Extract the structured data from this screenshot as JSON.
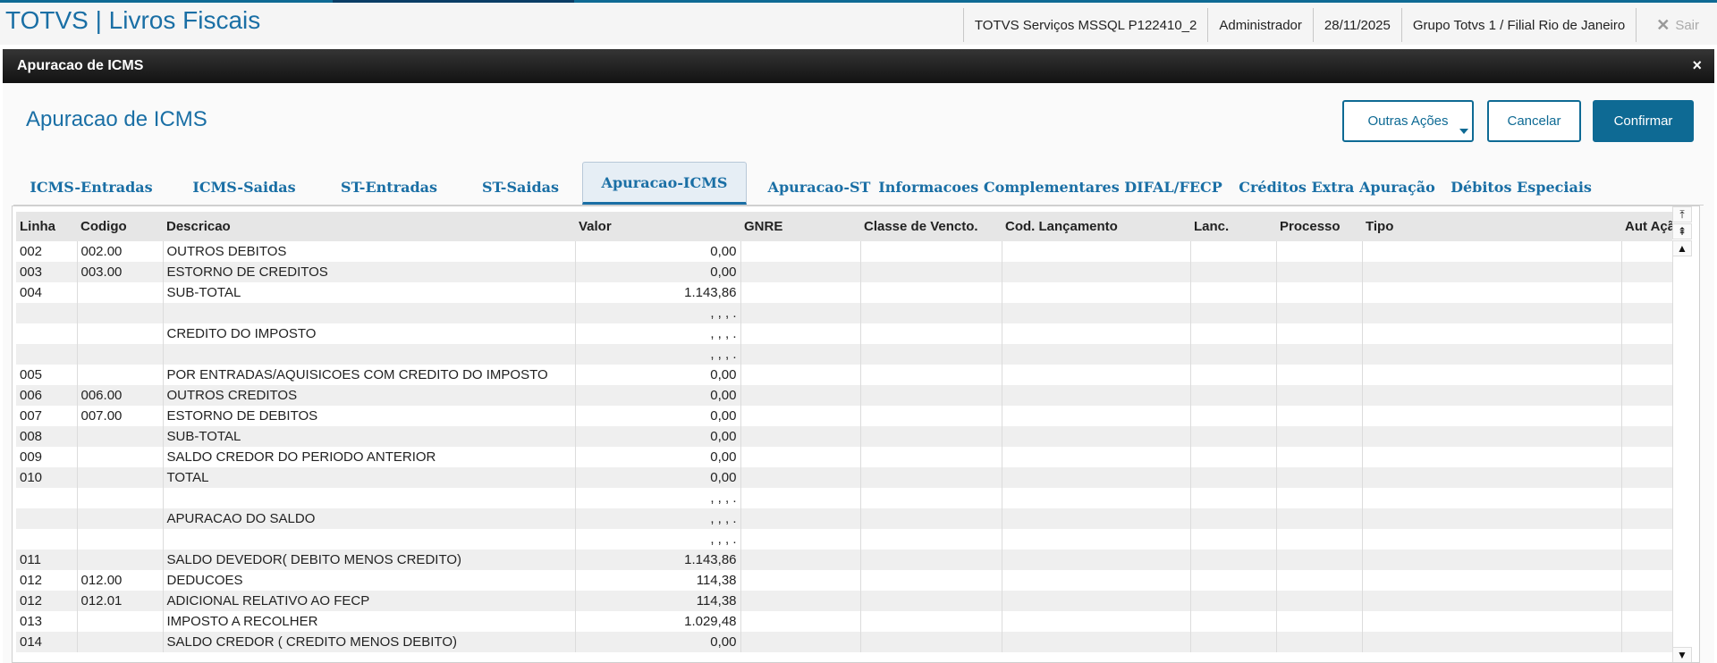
{
  "app": {
    "title": "TOTVS | Livros Fiscais",
    "server": "TOTVS Serviços MSSQL P122410_2",
    "user": "Administrador",
    "date": "28/11/2025",
    "branch": "Grupo Totvs 1 / Filial Rio de Janeiro",
    "exit_label": "Sair"
  },
  "dialog": {
    "title": "Apuracao de ICMS",
    "close_icon": "×",
    "heading": "Apuracao de ICMS",
    "buttons": {
      "other_actions": "Outras Ações",
      "cancel": "Cancelar",
      "confirm": "Confirmar"
    }
  },
  "tabs": [
    {
      "label": "ICMS-Entradas",
      "active": false
    },
    {
      "label": "ICMS-Saidas",
      "active": false
    },
    {
      "label": "ST-Entradas",
      "active": false
    },
    {
      "label": "ST-Saidas",
      "active": false
    },
    {
      "label": "Apuracao-ICMS",
      "active": true
    },
    {
      "label": "Apuracao-ST",
      "active": false
    },
    {
      "label": "Informacoes Complementares",
      "active": false
    },
    {
      "label": "DIFAL/FECP",
      "active": false
    },
    {
      "label": "Créditos Extra Apuração",
      "active": false
    },
    {
      "label": "Débitos Especiais",
      "active": false
    }
  ],
  "grid": {
    "columns": [
      "Linha",
      "Codigo",
      "Descricao",
      "Valor",
      "GNRE",
      "Classe de Vencto.",
      "Cod. Lançamento",
      "Lanc.",
      "Processo",
      "Tipo",
      "Aut Açã"
    ],
    "rows": [
      [
        "002",
        "002.00",
        "OUTROS DEBITOS",
        "0,00"
      ],
      [
        "003",
        "003.00",
        "ESTORNO DE CREDITOS",
        "0,00"
      ],
      [
        "004",
        "",
        "SUB-TOTAL",
        "1.143,86"
      ],
      [
        "",
        "",
        "",
        ", , , ."
      ],
      [
        "",
        "",
        "CREDITO DO IMPOSTO",
        ", , , ."
      ],
      [
        "",
        "",
        "",
        ", , , ."
      ],
      [
        "005",
        "",
        "POR ENTRADAS/AQUISICOES COM CREDITO DO IMPOSTO",
        "0,00"
      ],
      [
        "006",
        "006.00",
        "OUTROS CREDITOS",
        "0,00"
      ],
      [
        "007",
        "007.00",
        "ESTORNO DE DEBITOS",
        "0,00"
      ],
      [
        "008",
        "",
        "SUB-TOTAL",
        "0,00"
      ],
      [
        "009",
        "",
        "SALDO CREDOR DO PERIODO ANTERIOR",
        "0,00"
      ],
      [
        "010",
        "",
        "TOTAL",
        "0,00"
      ],
      [
        "",
        "",
        "",
        ", , , ."
      ],
      [
        "",
        "",
        "APURACAO DO SALDO",
        ", , , ."
      ],
      [
        "",
        "",
        "",
        ", , , ."
      ],
      [
        "011",
        "",
        "SALDO DEVEDOR( DEBITO MENOS CREDITO)",
        "1.143,86"
      ],
      [
        "012",
        "012.00",
        "DEDUCOES",
        "114,38"
      ],
      [
        "012",
        "012.01",
        "ADICIONAL RELATIVO AO FECP",
        "114,38"
      ],
      [
        "013",
        "",
        "IMPOSTO A RECOLHER",
        "1.029,48"
      ],
      [
        "014",
        "",
        "SALDO CREDOR ( CREDITO MENOS DEBITO)",
        "0,00"
      ]
    ]
  },
  "scroll_icons": {
    "top": "⤒",
    "page_up": "⇞",
    "up": "▲",
    "down": "▼"
  },
  "colors": {
    "brand": "#1a6fa5",
    "primary_button": "#0e6a94",
    "titlebar": "#1a1a1a"
  }
}
